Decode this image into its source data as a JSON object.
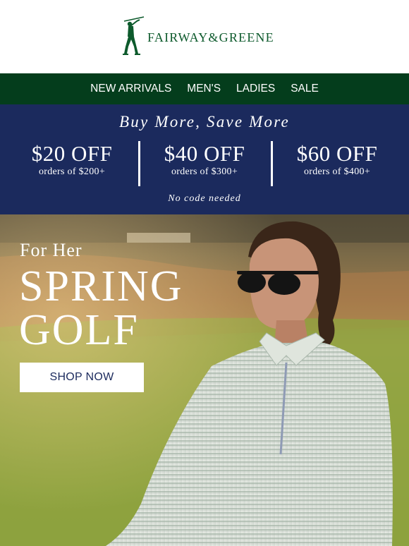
{
  "brand": {
    "name": "FAIRWAY&GREENE",
    "logo_icon": "golfer-logo-icon",
    "colors": {
      "green": "#0d5a2c",
      "nav_green": "#043d1c",
      "navy": "#1b2a5d"
    }
  },
  "nav": {
    "items": [
      {
        "label": "NEW ARRIVALS"
      },
      {
        "label": "MEN'S"
      },
      {
        "label": "LADIES"
      },
      {
        "label": "SALE"
      }
    ]
  },
  "promo": {
    "title": "Buy More, Save More",
    "offers": [
      {
        "amount": "$20 OFF",
        "condition": "orders of $200+"
      },
      {
        "amount": "$40 OFF",
        "condition": "orders of $300+"
      },
      {
        "amount": "$60 OFF",
        "condition": "orders of $400+"
      }
    ],
    "note": "No code needed"
  },
  "hero": {
    "kicker": "For Her",
    "title_line1": "SPRING",
    "title_line2": "GOLF",
    "cta_label": "SHOP NOW"
  }
}
